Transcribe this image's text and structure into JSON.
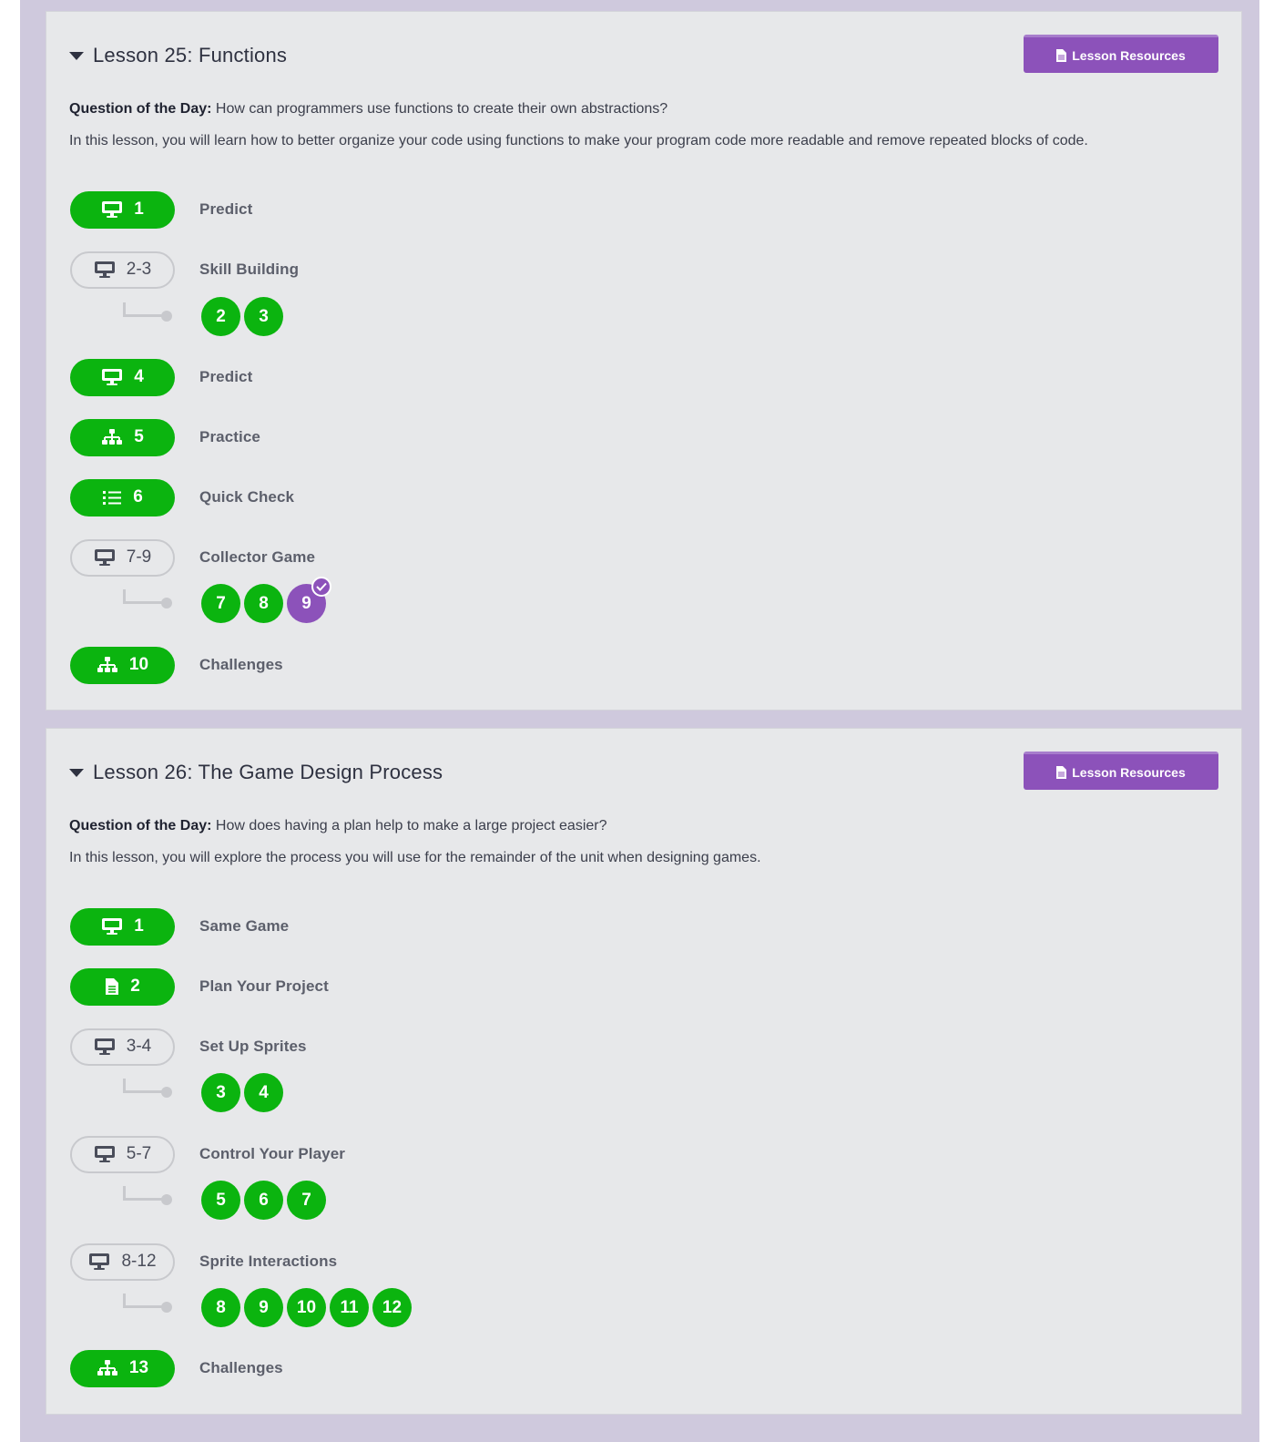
{
  "colors": {
    "green": "#0bb40f",
    "purple": "#8c52ba",
    "frame": "#cfc9dd",
    "card": "#e7e8ea"
  },
  "lessons": [
    {
      "title": "Lesson 25: Functions",
      "resources_label": "Lesson Resources",
      "qotd_label": "Question of the Day:",
      "qotd_text": "How can programmers use functions to create their own abstractions?",
      "description": "In this lesson, you will learn how to better organize your code using functions to make your program code more readable and remove repeated blocks of code.",
      "activities": [
        {
          "icon": "monitor-icon",
          "number": "1",
          "label": "Predict",
          "style": "complete"
        },
        {
          "icon": "monitor-icon",
          "number": "2-3",
          "label": "Skill Building",
          "style": "group",
          "levels": [
            "2",
            "3"
          ]
        },
        {
          "icon": "monitor-icon",
          "number": "4",
          "label": "Predict",
          "style": "complete"
        },
        {
          "icon": "hierarchy-icon",
          "number": "5",
          "label": "Practice",
          "style": "complete"
        },
        {
          "icon": "list-icon",
          "number": "6",
          "label": "Quick Check",
          "style": "complete"
        },
        {
          "icon": "monitor-icon",
          "number": "7-9",
          "label": "Collector Game",
          "style": "group",
          "levels": [
            "7",
            "8",
            "9"
          ],
          "current_level": "9"
        },
        {
          "icon": "hierarchy-icon",
          "number": "10",
          "label": "Challenges",
          "style": "complete"
        }
      ]
    },
    {
      "title": "Lesson 26: The Game Design Process",
      "resources_label": "Lesson Resources",
      "qotd_label": "Question of the Day:",
      "qotd_text": "How does having a plan help to make a large project easier?",
      "description": "In this lesson, you will explore the process you will use for the remainder of the unit when designing games.",
      "activities": [
        {
          "icon": "monitor-icon",
          "number": "1",
          "label": "Same Game",
          "style": "complete"
        },
        {
          "icon": "document-icon",
          "number": "2",
          "label": "Plan Your Project",
          "style": "complete"
        },
        {
          "icon": "monitor-icon",
          "number": "3-4",
          "label": "Set Up Sprites",
          "style": "group",
          "levels": [
            "3",
            "4"
          ]
        },
        {
          "icon": "monitor-icon",
          "number": "5-7",
          "label": "Control Your Player",
          "style": "group",
          "levels": [
            "5",
            "6",
            "7"
          ]
        },
        {
          "icon": "monitor-icon",
          "number": "8-12",
          "label": "Sprite Interactions",
          "style": "group",
          "levels": [
            "8",
            "9",
            "10",
            "11",
            "12"
          ]
        },
        {
          "icon": "hierarchy-icon",
          "number": "13",
          "label": "Challenges",
          "style": "complete"
        }
      ]
    }
  ]
}
